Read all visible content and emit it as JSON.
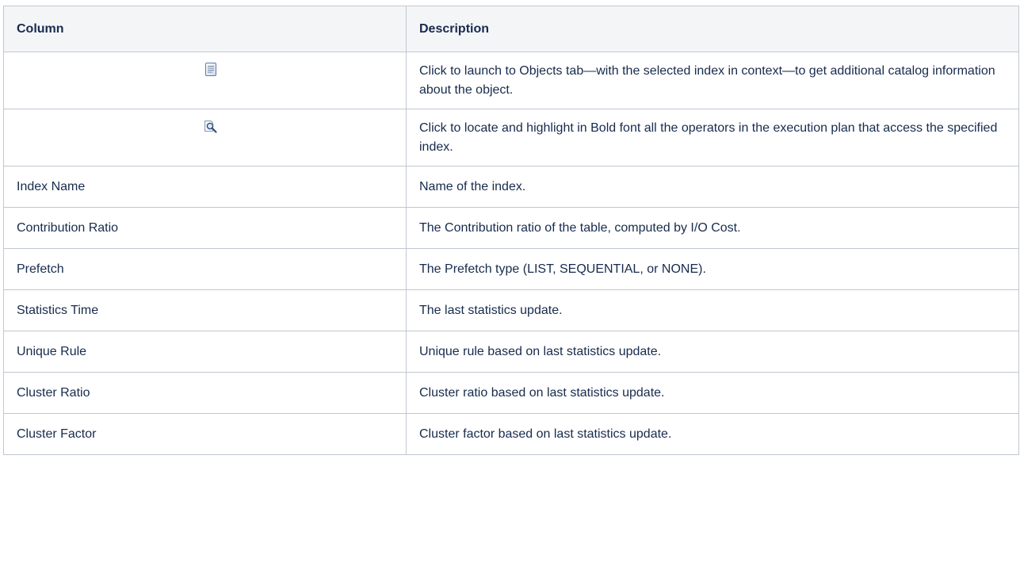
{
  "table": {
    "headers": {
      "column": "Column",
      "description": "Description"
    },
    "rows": [
      {
        "column_icon": "document-icon",
        "description": "Click to launch to Objects tab—with the selected index in context—to get additional catalog information about the object."
      },
      {
        "column_icon": "locate-magnifier-icon",
        "description": "Click to locate and highlight in Bold font all the operators in the execution plan that access the specified index."
      },
      {
        "column": "Index Name",
        "description": "Name of the index."
      },
      {
        "column": "Contribution Ratio",
        "description": "The Contribution ratio of the table, computed by I/O Cost."
      },
      {
        "column": "Prefetch",
        "description": "The Prefetch type (LIST, SEQUENTIAL, or NONE)."
      },
      {
        "column": "Statistics Time",
        "description": "The last statistics update."
      },
      {
        "column": "Unique Rule",
        "description": "Unique rule based on last statistics update."
      },
      {
        "column": "Cluster Ratio",
        "description": "Cluster ratio based on last statistics update."
      },
      {
        "column": "Cluster Factor",
        "description": "Cluster factor based on last statistics update."
      }
    ]
  }
}
